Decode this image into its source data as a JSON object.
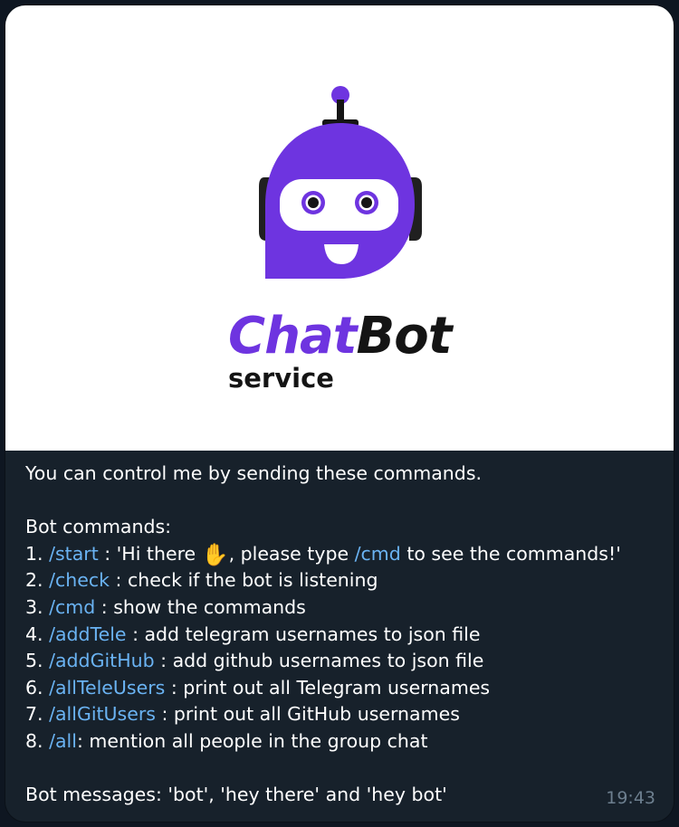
{
  "logo": {
    "word_part_1": "Chat",
    "word_part_2": "Bot",
    "subtitle": "service",
    "brand_color": "#6e34e0",
    "icon": "robot-chat-bubble-icon"
  },
  "message": {
    "intro": "You can control me by sending these commands.",
    "commands_heading": "Bot commands:",
    "commands": [
      {
        "num": "1. ",
        "cmd": "/start",
        "before": " : 'Hi there ",
        "emoji": "✋",
        "middle": ", please type ",
        "inline_cmd": "/cmd",
        "after": " to see the commands!'"
      },
      {
        "num": "2. ",
        "cmd": "/check",
        "desc": " : check if the bot is listening"
      },
      {
        "num": "3. ",
        "cmd": "/cmd",
        "desc": " : show the commands"
      },
      {
        "num": "4. ",
        "cmd": "/addTele",
        "desc": " : add telegram usernames to json file"
      },
      {
        "num": "5. ",
        "cmd": "/addGitHub",
        "desc": " : add github usernames to json file"
      },
      {
        "num": "6. ",
        "cmd": "/allTeleUsers",
        "desc": " : print out all Telegram usernames"
      },
      {
        "num": "7. ",
        "cmd": "/allGitUsers",
        "desc": " : print out all GitHub usernames"
      },
      {
        "num": "8. ",
        "cmd": "/all",
        "desc": ": mention all people in the group chat"
      }
    ],
    "bot_messages": "Bot messages: 'bot', 'hey there' and 'hey bot'",
    "time": "19:43"
  },
  "colors": {
    "background": "#0e1621",
    "bubble": "#17212b",
    "link": "#6ab3f3",
    "text": "#ffffff",
    "timestamp": "#6d7f8f"
  }
}
